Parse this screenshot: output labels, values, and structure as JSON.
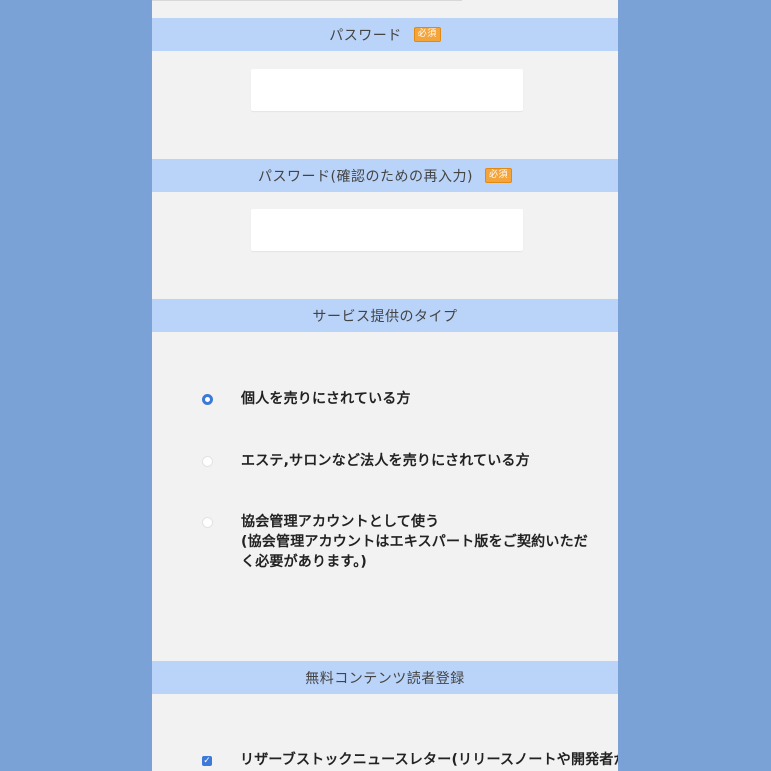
{
  "password_section": {
    "title": "パスワード",
    "required_badge": "必須",
    "value": "",
    "placeholder": ""
  },
  "password_confirm_section": {
    "title": "パスワード(確認のための再入力)",
    "required_badge": "必須",
    "value": "",
    "placeholder": ""
  },
  "service_type_section": {
    "title": "サービス提供のタイプ",
    "options": [
      {
        "label": "個人を売りにされている方",
        "selected": true
      },
      {
        "label": "エステ,サロンなど法人を売りにされている方",
        "selected": false
      },
      {
        "label": "協会管理アカウントとして使う",
        "sub_label": "(協会管理アカウントはエキスパート版をご契約いただく必要があります。)",
        "selected": false
      }
    ]
  },
  "free_content_section": {
    "title": "無料コンテンツ読者登録",
    "items": [
      {
        "label": "リザーブストックニュースレター(リリースノートや開発者からのお",
        "checked": true
      }
    ]
  },
  "colors": {
    "background": "#7aa2d6",
    "panel": "#f2f2f2",
    "header": "#b9d3f9",
    "accent": "#3d79d8",
    "badge": "#f3a53c"
  }
}
